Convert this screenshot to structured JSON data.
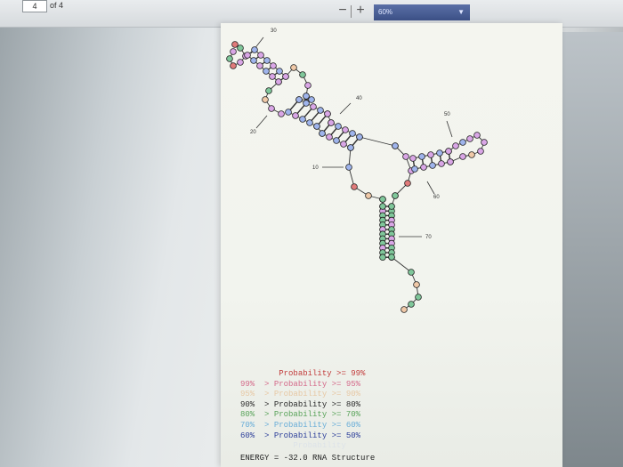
{
  "toolbar": {
    "page_number": "4",
    "page_of": "of 4",
    "zoom_minus": "−",
    "zoom_plus": "+",
    "zoom_value": "60%"
  },
  "structure": {
    "index_labels": [
      "30",
      "40",
      "20",
      "50",
      "10",
      "60",
      "70"
    ]
  },
  "legend": {
    "rows": [
      {
        "lower": "",
        "op1": "",
        "word": "Probability",
        "op2": ">=",
        "upper": "99%",
        "color": "#c23b3b"
      },
      {
        "lower": "99%",
        "op1": ">",
        "word": "Probability",
        "op2": ">=",
        "upper": "95%",
        "color": "#d46a8a"
      },
      {
        "lower": "95%",
        "op1": ">",
        "word": "Probability",
        "op2": ">=",
        "upper": "90%",
        "color": "#e7c8a4"
      },
      {
        "lower": "90%",
        "op1": ">",
        "word": "Probability",
        "op2": ">=",
        "upper": "80%",
        "color": "#2a2a2a"
      },
      {
        "lower": "80%",
        "op1": ">",
        "word": "Probability",
        "op2": ">=",
        "upper": "70%",
        "color": "#5aa35a"
      },
      {
        "lower": "70%",
        "op1": ">",
        "word": "Probability",
        "op2": ">=",
        "upper": "60%",
        "color": "#6aaed8"
      },
      {
        "lower": "60%",
        "op1": ">",
        "word": "Probability",
        "op2": ">=",
        "upper": "50%",
        "color": "#2c3f9a"
      }
    ],
    "faded_row": "Probability"
  },
  "footer": {
    "energy_label": "ENERGY",
    "energy_eq": "=",
    "energy_value": "-32.0",
    "title": "RNA Structure"
  },
  "colors": {
    "pink": "#d9a6e6",
    "blue": "#9fb4ec",
    "green": "#7fc79a",
    "peach": "#f0c9a8",
    "red": "#e07a7a"
  }
}
